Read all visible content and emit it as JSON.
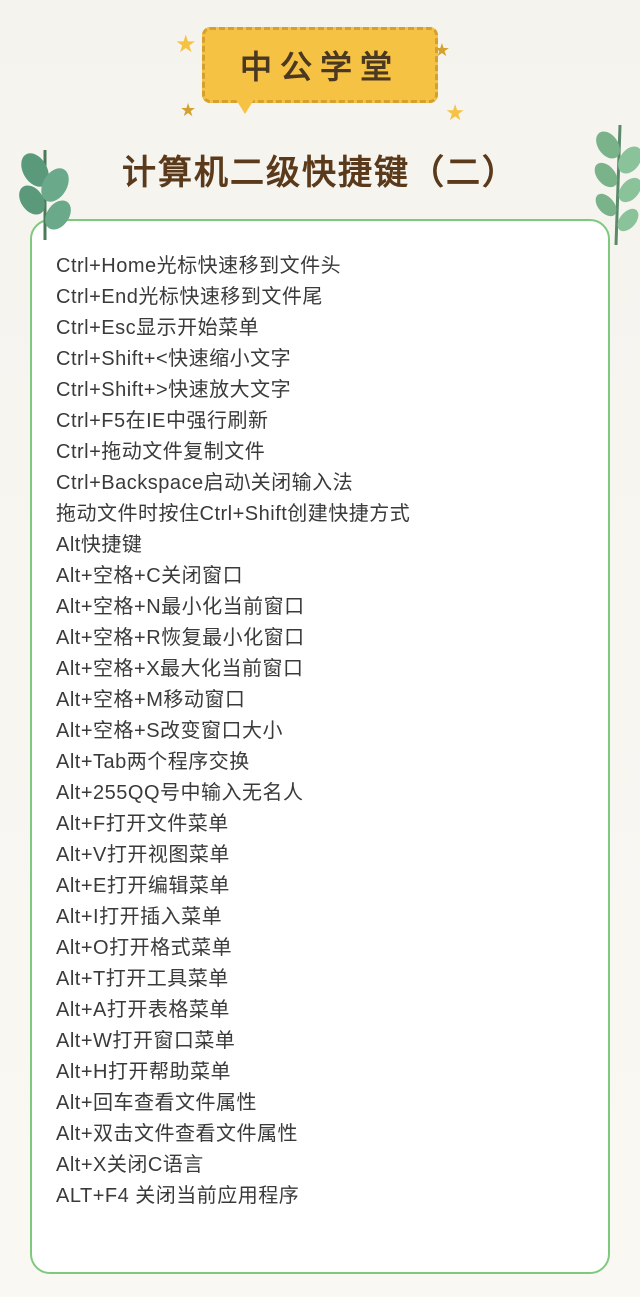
{
  "badge_label": "中公学堂",
  "title": "计算机二级快捷键（二）",
  "shortcuts": [
    "Ctrl+Home光标快速移到文件头",
    "Ctrl+End光标快速移到文件尾",
    "Ctrl+Esc显示开始菜单",
    "Ctrl+Shift+<快速缩小文字",
    "Ctrl+Shift+>快速放大文字",
    "Ctrl+F5在IE中强行刷新",
    "Ctrl+拖动文件复制文件",
    "Ctrl+Backspace启动\\关闭输入法",
    "拖动文件时按住Ctrl+Shift创建快捷方式",
    "Alt快捷键",
    "Alt+空格+C关闭窗口",
    "Alt+空格+N最小化当前窗口",
    "Alt+空格+R恢复最小化窗口",
    "Alt+空格+X最大化当前窗口",
    "Alt+空格+M移动窗口",
    "Alt+空格+S改变窗口大小",
    "Alt+Tab两个程序交换",
    "Alt+255QQ号中输入无名人",
    "Alt+F打开文件菜单",
    "Alt+V打开视图菜单",
    "Alt+E打开编辑菜单",
    "Alt+I打开插入菜单",
    "Alt+O打开格式菜单",
    "Alt+T打开工具菜单",
    "Alt+A打开表格菜单",
    "Alt+W打开窗口菜单",
    "Alt+H打开帮助菜单",
    "Alt+回车查看文件属性",
    "Alt+双击文件查看文件属性",
    "Alt+X关闭C语言",
    "ALT+F4 关闭当前应用程序"
  ]
}
